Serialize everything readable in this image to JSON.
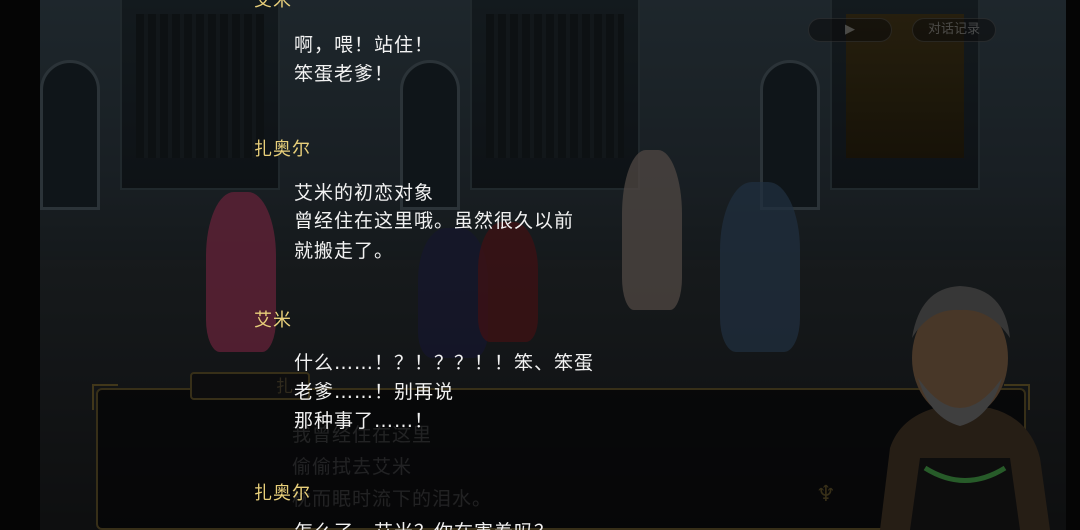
{
  "ui": {
    "play_button": "▶",
    "log_button": "对话记录"
  },
  "background_dialog": {
    "speaker": "扎",
    "lines": [
      "我曾经住在这里",
      "偷偷拭去艾米",
      "枕而眠时流下的泪水。"
    ]
  },
  "log": [
    {
      "speaker": "艾米",
      "lines": [
        "啊，喂！站住！",
        "笨蛋老爹！"
      ]
    },
    {
      "speaker": "扎奥尔",
      "lines": [
        "艾米的初恋对象",
        "曾经住在这里哦。虽然很久以前",
        "就搬走了。"
      ]
    },
    {
      "speaker": "艾米",
      "lines": [
        "什么……！？！？？！！笨、笨蛋",
        "老爹……！别再说",
        "那种事了……！"
      ]
    },
    {
      "speaker": "扎奥尔",
      "lines": [
        "怎么了，艾米？你在害羞吗？"
      ]
    }
  ],
  "colors": {
    "speaker_name": "#e8cf7a",
    "dialog_text": "#f2f2f2",
    "frame_gold": "#6a5a2e"
  }
}
